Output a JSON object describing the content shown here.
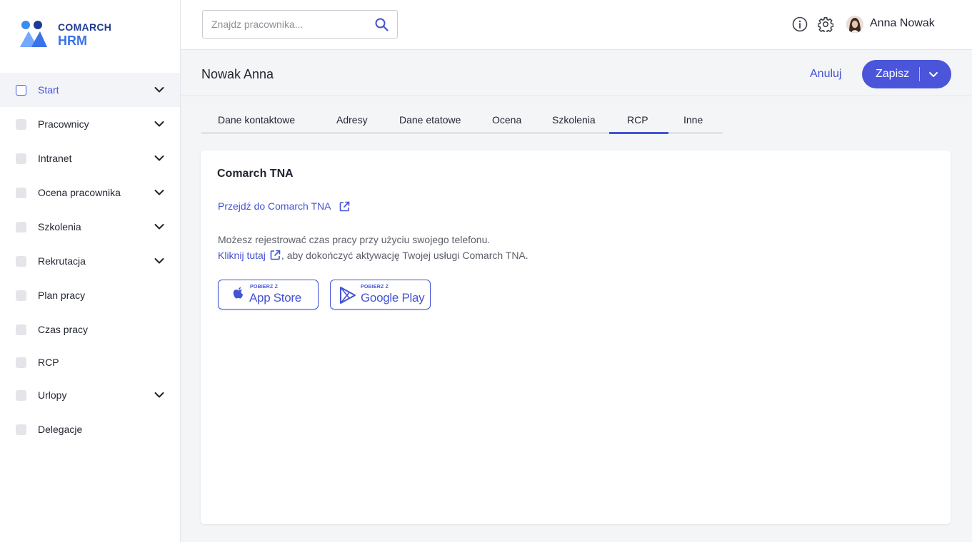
{
  "brand": {
    "line1": "COMARCH",
    "line2": "HRM"
  },
  "colors": {
    "accent": "#4453d6",
    "save_button": "#4a55d9",
    "logo_dark": "#1f3a93",
    "logo_light": "#3a72e8"
  },
  "search": {
    "placeholder": "Znajdz pracownika..."
  },
  "user": {
    "name": "Anna Nowak"
  },
  "sidebar": {
    "items": [
      {
        "label": "Start",
        "active": true,
        "expandable": true
      },
      {
        "label": "Pracownicy",
        "expandable": true
      },
      {
        "label": "Intranet",
        "expandable": true
      },
      {
        "label": "Ocena pracownika",
        "expandable": true
      },
      {
        "label": "Szkolenia",
        "expandable": true
      },
      {
        "label": "Rekrutacja",
        "expandable": true
      },
      {
        "label": "Plan pracy",
        "expandable": false
      },
      {
        "label": "Czas pracy",
        "expandable": false
      },
      {
        "label": "RCP",
        "expandable": false
      },
      {
        "label": "Urlopy",
        "expandable": true
      },
      {
        "label": "Delegacje",
        "expandable": false
      }
    ]
  },
  "header": {
    "title": "Nowak Anna",
    "cancel_label": "Anuluj",
    "save_label": "Zapisz"
  },
  "tabs": [
    {
      "label": "Dane kontaktowe"
    },
    {
      "label": "Adresy"
    },
    {
      "label": "Dane etatowe"
    },
    {
      "label": "Ocena"
    },
    {
      "label": "Szkolenia"
    },
    {
      "label": "RCP",
      "active": true
    },
    {
      "label": "Inne"
    }
  ],
  "card": {
    "title": "Comarch TNA",
    "link_label": "Przejdź do Comarch TNA",
    "desc_line1": "Możesz rejestrować czas pracy przy użyciu swojego telefonu.",
    "desc_link": "Kliknij tutaj",
    "desc_line2_rest": ", aby dokończyć aktywację Twojej usługi Comarch TNA.",
    "appstore": {
      "small": "POBIERZ Z",
      "big": "App Store"
    },
    "googleplay": {
      "small": "POBIERZ Z",
      "big": "Google Play"
    }
  }
}
